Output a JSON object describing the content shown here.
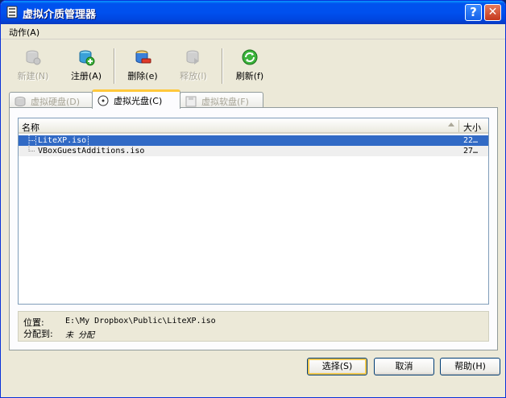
{
  "window": {
    "title": "虚拟介质管理器",
    "help_glyph": "?",
    "close_glyph": "✕"
  },
  "menu": {
    "action": "动作(A)"
  },
  "toolbar": {
    "new_label": "新建(N)",
    "register_label": "注册(A)",
    "remove_label": "删除(e)",
    "release_label": "释放(l)",
    "refresh_label": "刷新(f)"
  },
  "tabs": [
    {
      "label": "虚拟硬盘(D)"
    },
    {
      "label": "虚拟光盘(C)"
    },
    {
      "label": "虚拟软盘(F)"
    }
  ],
  "list": {
    "columns": [
      "名称",
      "大小"
    ],
    "rows": [
      {
        "name": "LiteXP.iso",
        "size": "22…"
      },
      {
        "name": "VBoxGuestAdditions.iso",
        "size": "27…"
      }
    ]
  },
  "info": {
    "location_label": "位置:",
    "location_value": "E:\\My Dropbox\\Public\\LiteXP.iso",
    "attached_label": "分配到:",
    "attached_value": "未 分配"
  },
  "buttons": {
    "select": "选择(S)",
    "cancel": "取消",
    "help": "帮助(H)"
  },
  "colors": {
    "title_bar": "#0053ee",
    "selection": "#316ac5",
    "active_tab_accent": "#ffc83c"
  }
}
